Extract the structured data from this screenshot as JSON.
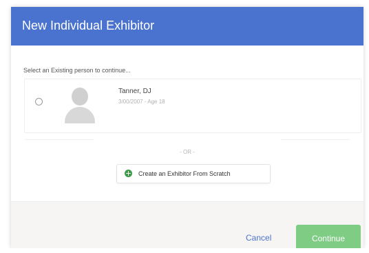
{
  "dialog": {
    "title": "New Individual Exhibitor",
    "instruction": "Select an Existing person to continue...",
    "person": {
      "name": "Tanner, DJ",
      "details": "3/00/2007 - Age 18"
    },
    "or_label": "- OR -",
    "create_button_label": "Create an Exhibitor From Scratch",
    "cancel_label": "Cancel",
    "continue_label": "Continue",
    "continue_enabled": false
  },
  "colors": {
    "header": "#4a72cf",
    "accent_green": "#3f9a48",
    "continue_disabled": "#7fcc85",
    "link": "#4a72cf"
  },
  "icons": {
    "radio": "radio-unchecked-icon",
    "avatar": "person-placeholder-icon",
    "create": "plus-circle-icon"
  }
}
